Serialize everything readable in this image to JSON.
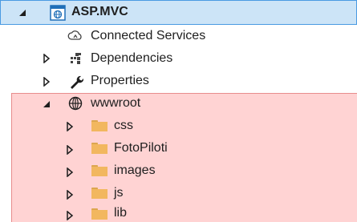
{
  "tree": {
    "project": {
      "label": "ASP.MVC",
      "icon": "web-project-icon",
      "expanded": true
    },
    "items": [
      {
        "label": "Connected Services",
        "icon": "connected-services-icon",
        "has_children": false
      },
      {
        "label": "Dependencies",
        "icon": "dependencies-icon",
        "has_children": true
      },
      {
        "label": "Properties",
        "icon": "wrench-icon",
        "has_children": true
      },
      {
        "label": "wwwroot",
        "icon": "globe-icon",
        "has_children": true,
        "expanded": true,
        "children": [
          {
            "label": "css",
            "icon": "folder-icon"
          },
          {
            "label": "FotoPiloti",
            "icon": "folder-icon"
          },
          {
            "label": "images",
            "icon": "folder-icon"
          },
          {
            "label": "js",
            "icon": "folder-icon"
          },
          {
            "label": "lib",
            "icon": "folder-icon"
          }
        ]
      }
    ]
  },
  "colors": {
    "selection_bg": "#cce4f7",
    "selection_border": "#4a9ae2",
    "highlight_bg": "#ffd3d3",
    "folder": "#f2b75f"
  }
}
